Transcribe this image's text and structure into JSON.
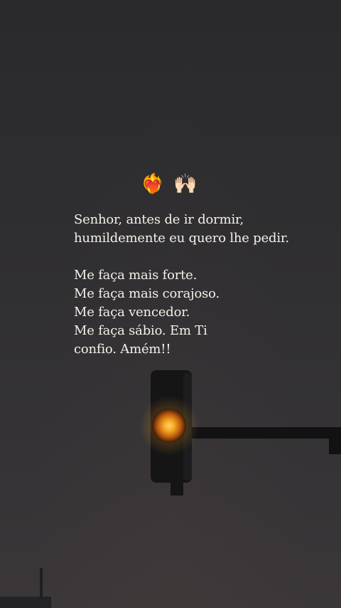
{
  "emoji": {
    "heart_on_fire": "❤️‍🔥",
    "raised_hands": "🙌🏻"
  },
  "prayer": {
    "line1": "Senhor, antes de ir dormir,",
    "line2": "humildemente eu quero lhe pedir.",
    "line3": "Me faça mais forte.",
    "line4": "Me faça mais corajoso.",
    "line5": "Me faça vencedor.",
    "line6": "Me faça sábio. Em Ti",
    "line7": "confio. Amém!!"
  },
  "colors": {
    "background": "#2c2b2e",
    "text": "#f4f1ea",
    "traffic_light_glow": "#f3a020"
  }
}
